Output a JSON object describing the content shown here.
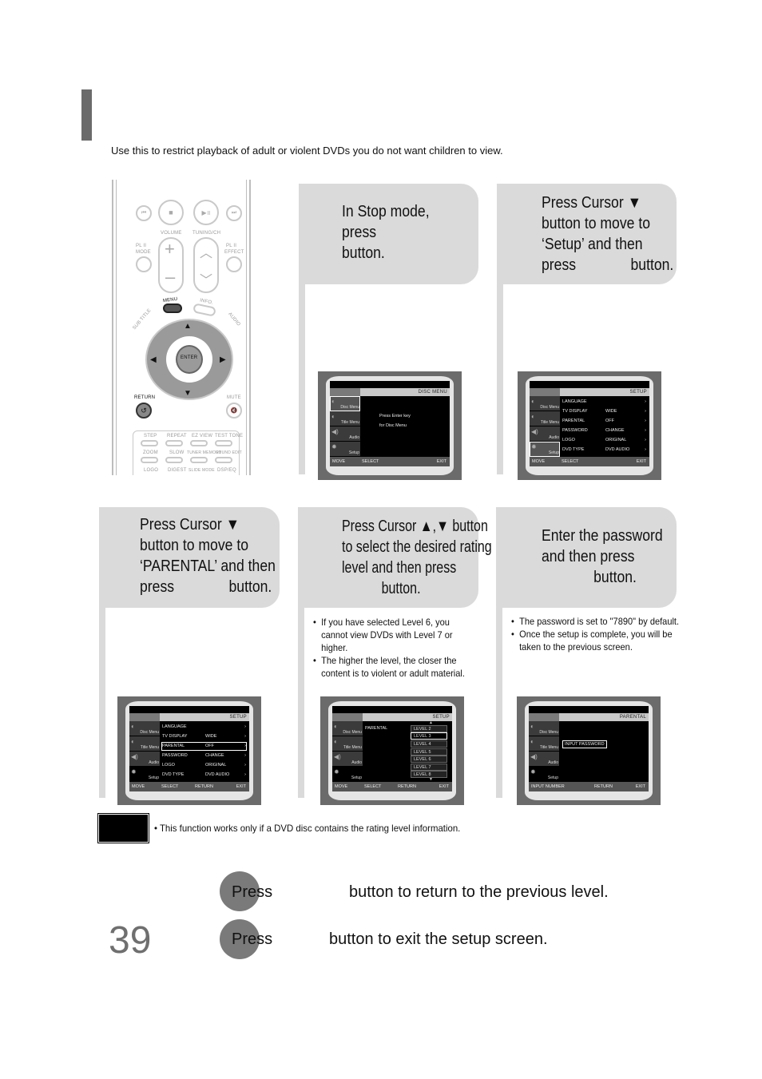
{
  "intro": "Use this to restrict playback of adult or violent DVDs you do not want children to view.",
  "remote": {
    "labels": {
      "volume": "VOLUME",
      "tuning": "TUNING/CH",
      "mode": "MODE",
      "effect": "EFFECT",
      "pl2_left": "PL II",
      "pl2_right": "PL II",
      "menu": "MENU",
      "info": "INFO.",
      "subtitle": "SUB TITLE",
      "audio": "AUDIO",
      "enter": "ENTER",
      "return": "RETURN",
      "mute": "MUTE",
      "step": "STEP",
      "repeat": "REPEAT",
      "ezview": "EZ VIEW",
      "testtone": "TEST TONE",
      "ntpal": "NT/PAL",
      "zoom": "ZOOM",
      "slow": "SLOW",
      "tunermem": "TUNER MEMORY",
      "soundedit": "SOUND EDIT",
      "most": "MO/ST",
      "pscan": "P.SCAN",
      "logo": "LOGO",
      "digest": "DIGEST",
      "slidemode": "SLIDE MODE",
      "dspeq": "DSP/EQ"
    }
  },
  "steps": [
    {
      "lines": [
        "In Stop mode,",
        "press",
        "button."
      ]
    },
    {
      "lines": [
        "Press Cursor ▼",
        "button to move to",
        "‘Setup’ and then",
        "press              button."
      ]
    },
    {
      "lines": [
        "Press Cursor ▼",
        "button to move to",
        "‘PARENTAL’ and then",
        "press              button."
      ]
    },
    {
      "lines": [
        "Press Cursor ▲,▼ button",
        "to select the desired rating",
        "level and then press",
        "button."
      ],
      "notes": [
        "If you have selected Level 6, you cannot view DVDs with Level 7 or higher.",
        "The higher the level, the closer the content is to violent or adult material."
      ]
    },
    {
      "lines": [
        "Enter the password",
        "and then press",
        "button."
      ],
      "notes": [
        "The password is set to \"7890\" by default.",
        "Once the setup is complete, you will be taken to the previous screen."
      ]
    }
  ],
  "screens": {
    "sidebar": [
      "Disc Menu",
      "Title Menu",
      "Audio",
      "Setup"
    ],
    "disc_menu": {
      "header": "DISC MENU",
      "lines": [
        "Press Enter key",
        "for Disc Menu"
      ],
      "footer": {
        "move": "MOVE",
        "select": "SELECT",
        "exit": "EXIT"
      }
    },
    "setup": {
      "header": "SETUP",
      "rows": [
        {
          "key": "LANGUAGE",
          "value": ""
        },
        {
          "key": "TV DISPLAY",
          "value": "WIDE"
        },
        {
          "key": "PARENTAL",
          "value": "OFF"
        },
        {
          "key": "PASSWORD",
          "value": "CHANGE"
        },
        {
          "key": "LOGO",
          "value": "ORIGINAL"
        },
        {
          "key": "DVD TYPE",
          "value": "DVD AUDIO"
        }
      ],
      "footer": {
        "move": "MOVE",
        "select": "SELECT",
        "return": "RETURN",
        "exit": "EXIT"
      }
    },
    "parental_levels": {
      "header": "SETUP",
      "item": "PARENTAL",
      "levels": [
        "LEVEL 2",
        "LEVEL 3",
        "LEVEL 4",
        "LEVEL 5",
        "LEVEL 6",
        "LEVEL 7",
        "LEVEL 8"
      ],
      "selected": "LEVEL 3"
    },
    "password": {
      "header": "PARENTAL",
      "prompt": "INPUT PASSWORD",
      "footer": {
        "input": "INPUT NUMBER",
        "return": "RETURN",
        "exit": "EXIT"
      }
    }
  },
  "note": "This function works only if a DVD disc contains the rating level information.",
  "footer": {
    "press": "Press",
    "return_line": "button to return to the previous level.",
    "exit_line": "button to exit the setup screen."
  },
  "page_number": "39"
}
